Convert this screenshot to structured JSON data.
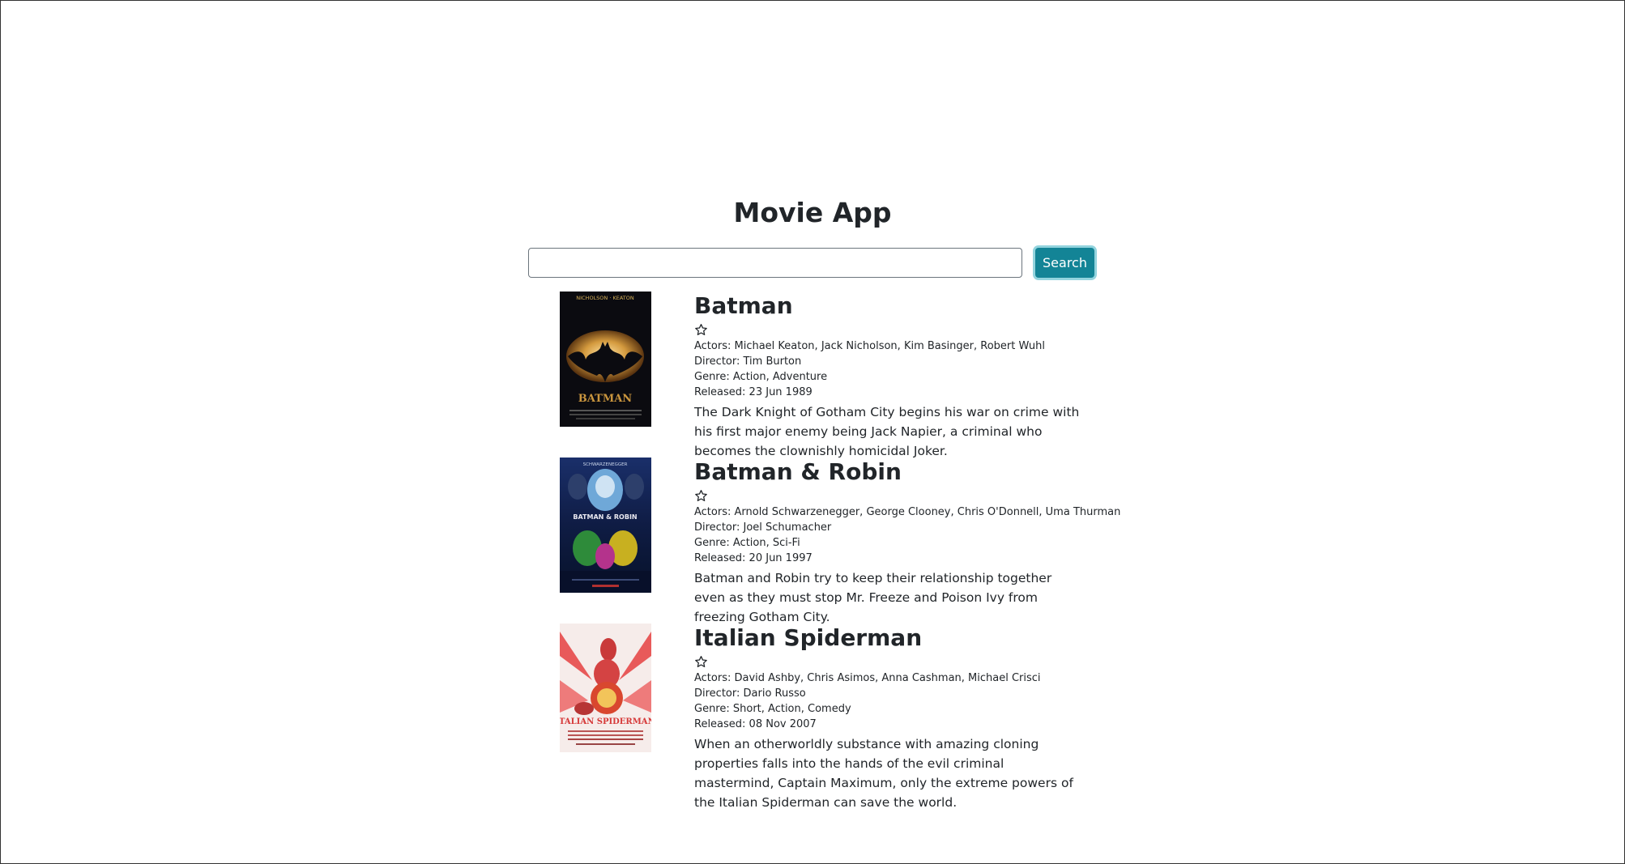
{
  "app": {
    "title": "Movie App"
  },
  "search": {
    "value": "",
    "placeholder": "",
    "button_label": "Search"
  },
  "movies": [
    {
      "title": "Batman",
      "favorite": false,
      "actors": "Actors: Michael Keaton, Jack Nicholson, Kim Basinger, Robert Wuhl",
      "director": "Director: Tim Burton",
      "genre": "Genre: Action, Adventure",
      "released": "Released: 23 Jun 1989",
      "plot": "The Dark Knight of Gotham City begins his war on crime with his first major enemy being Jack Napier, a criminal who becomes the clownishly homicidal Joker.",
      "poster": {
        "top_text": "NICHOLSON · KEATON",
        "bottom_text": "BATMAN"
      }
    },
    {
      "title": "Batman & Robin",
      "favorite": false,
      "actors": "Actors: Arnold Schwarzenegger, George Clooney, Chris O'Donnell, Uma Thurman",
      "director": "Director: Joel Schumacher",
      "genre": "Genre: Action, Sci-Fi",
      "released": "Released: 20 Jun 1997",
      "plot": "Batman and Robin try to keep their relationship together even as they must stop Mr. Freeze and Poison Ivy from freezing Gotham City.",
      "poster": {
        "top_text": "SCHWARZENEGGER",
        "middle_text": "BATMAN & ROBIN"
      }
    },
    {
      "title": "Italian Spiderman",
      "favorite": false,
      "actors": "Actors: David Ashby, Chris Asimos, Anna Cashman, Michael Crisci",
      "director": "Director: Dario Russo",
      "genre": "Genre: Short, Action, Comedy",
      "released": "Released: 08 Nov 2007",
      "plot": "When an otherworldly substance with amazing cloning properties falls into the hands of the evil criminal mastermind, Captain Maximum, only the extreme powers of the Italian Spiderman can save the world.",
      "poster": {
        "bottom_text": "ITALIAN SPIDERMAN"
      }
    }
  ]
}
